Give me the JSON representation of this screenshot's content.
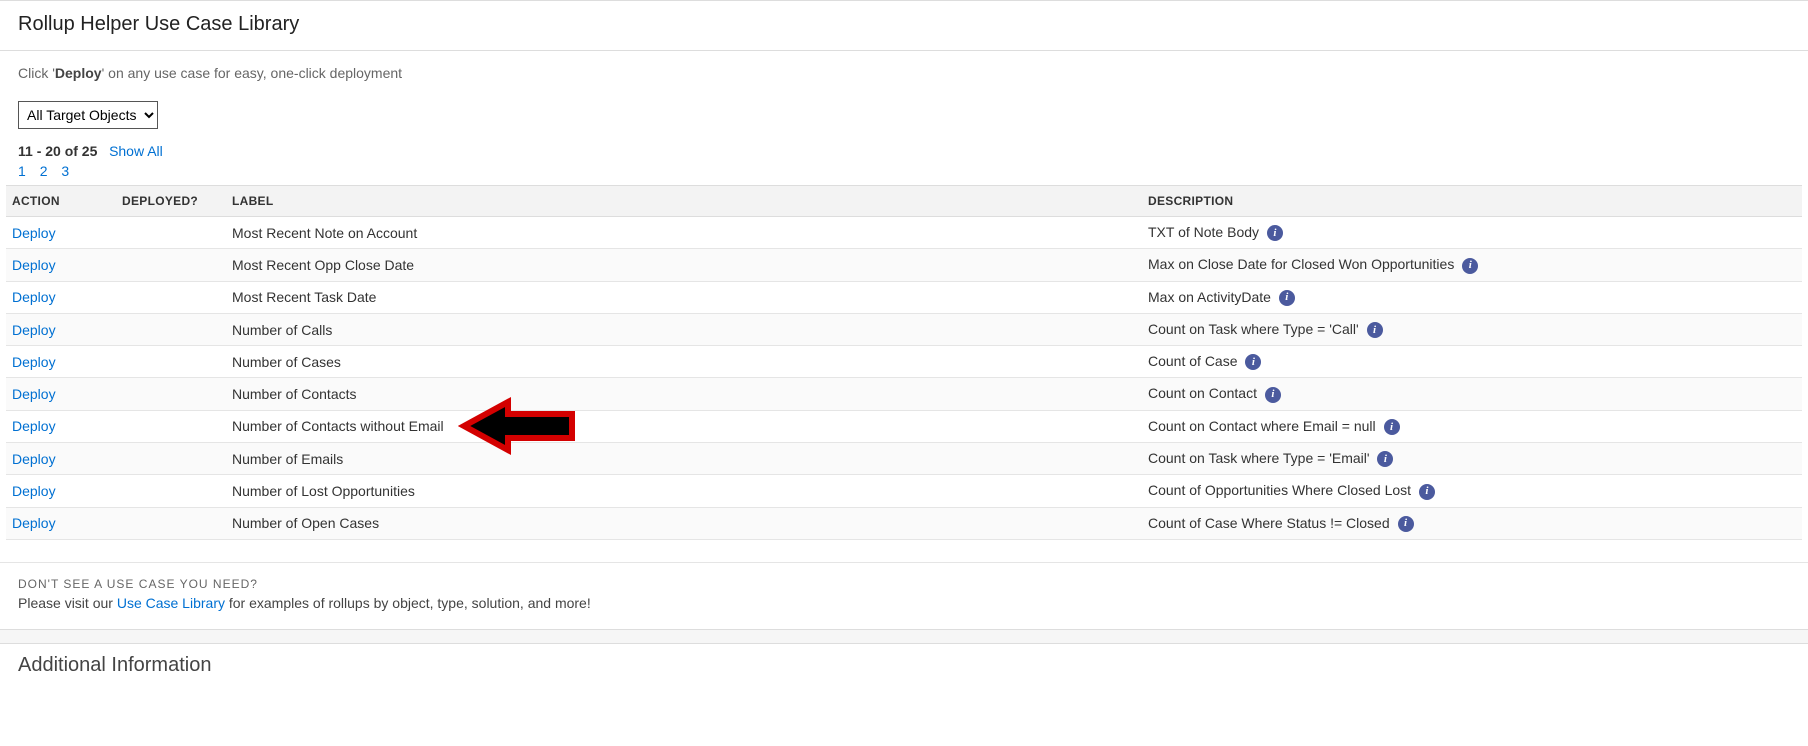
{
  "pageTitle": "Rollup Helper Use Case Library",
  "hintPrefix": "Click '",
  "hintBold": "Deploy",
  "hintSuffix": "' on any use case for easy, one-click deployment",
  "filterSelect": "All Target Objects",
  "pagerCount": "11 - 20 of 25",
  "showAll": "Show All",
  "pageNums": [
    "1",
    "2",
    "3"
  ],
  "columns": {
    "action": "ACTION",
    "deployed": "DEPLOYED?",
    "label": "LABEL",
    "description": "DESCRIPTION"
  },
  "deployLabel": "Deploy",
  "rows": [
    {
      "label": "Most Recent Note on Account",
      "desc": "TXT of Note Body"
    },
    {
      "label": "Most Recent Opp Close Date",
      "desc": "Max on Close Date for Closed Won Opportunities"
    },
    {
      "label": "Most Recent Task Date",
      "desc": "Max on ActivityDate"
    },
    {
      "label": "Number of Calls",
      "desc": "Count on Task where Type = 'Call'"
    },
    {
      "label": "Number of Cases",
      "desc": "Count of Case"
    },
    {
      "label": "Number of Contacts",
      "desc": "Count on Contact"
    },
    {
      "label": "Number of Contacts without Email",
      "desc": "Count on Contact where Email = null"
    },
    {
      "label": "Number of Emails",
      "desc": "Count on Task where Type = 'Email'"
    },
    {
      "label": "Number of Lost Opportunities",
      "desc": "Count of Opportunities Where Closed Lost"
    },
    {
      "label": "Number of Open Cases",
      "desc": "Count of Case Where Status != Closed"
    }
  ],
  "footerHeading": "DON'T SEE A USE CASE YOU NEED?",
  "footerPrefix": "Please visit our ",
  "footerLink": "Use Case Library",
  "footerSuffix": " for examples of rollups by object, type, solution, and more!",
  "additionalInfo": "Additional Information"
}
